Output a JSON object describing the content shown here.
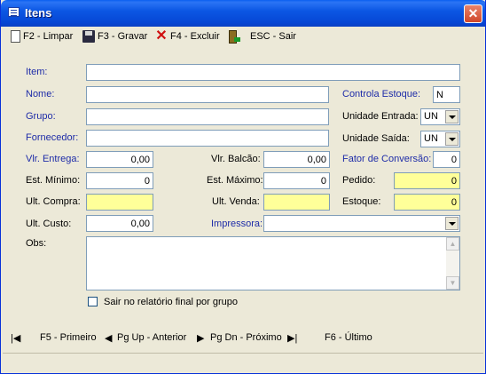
{
  "window": {
    "title": "Itens",
    "close_glyph": "✕"
  },
  "toolbar": {
    "limpar": "F2 - Limpar",
    "gravar": "F3 - Gravar",
    "excluir": "F4 - Excluir",
    "sair": "ESC - Sair"
  },
  "form": {
    "item": {
      "label": "Item:",
      "value": ""
    },
    "nome": {
      "label": "Nome:",
      "value": ""
    },
    "grupo": {
      "label": "Grupo:",
      "value": ""
    },
    "fornecedor": {
      "label": "Fornecedor:",
      "value": ""
    },
    "controla_estoque": {
      "label": "Controla Estoque:",
      "value": "N"
    },
    "unidade_entrada": {
      "label": "Unidade Entrada:",
      "value": "UN"
    },
    "unidade_saida": {
      "label": "Unidade Saída:",
      "value": "UN"
    },
    "vlr_entrega": {
      "label": "Vlr. Entrega:",
      "value": "0,00"
    },
    "vlr_balcao": {
      "label": "Vlr. Balcão:",
      "value": "0,00"
    },
    "fator_conversao": {
      "label": "Fator de Conversão:",
      "value": "0"
    },
    "est_minimo": {
      "label": "Est. Mínimo:",
      "value": "0"
    },
    "est_maximo": {
      "label": "Est. Máximo:",
      "value": "0"
    },
    "pedido": {
      "label": "Pedido:",
      "value": "0"
    },
    "ult_compra": {
      "label": "Ult. Compra:",
      "value": ""
    },
    "ult_venda": {
      "label": "Ult. Venda:",
      "value": ""
    },
    "estoque": {
      "label": "Estoque:",
      "value": "0"
    },
    "ult_custo": {
      "label": "Ult. Custo:",
      "value": "0,00"
    },
    "impressora": {
      "label": "Impressora:",
      "value": ""
    },
    "obs": {
      "label": "Obs:",
      "value": ""
    },
    "sair_relatorio": {
      "label": "Sair no relatório final por grupo",
      "checked": false
    }
  },
  "nav": {
    "first_glyph": "|◀",
    "primeiro": "F5 - Primeiro",
    "prev_glyph": "◀",
    "anterior": "Pg Up - Anterior",
    "next_glyph": "▶",
    "proximo": "Pg Dn - Próximo",
    "last_glyph": "▶|",
    "ultimo": "F6 - Último"
  },
  "colors": {
    "label_blue": "#1e2ca8",
    "highlight_yellow": "#ffff99",
    "title_blue": "#0646d4"
  },
  "icons": {
    "title": "window-list-icon",
    "limpar": "new-page-icon",
    "gravar": "floppy-disk-icon",
    "excluir": "red-x-icon",
    "sair": "exit-door-icon"
  }
}
